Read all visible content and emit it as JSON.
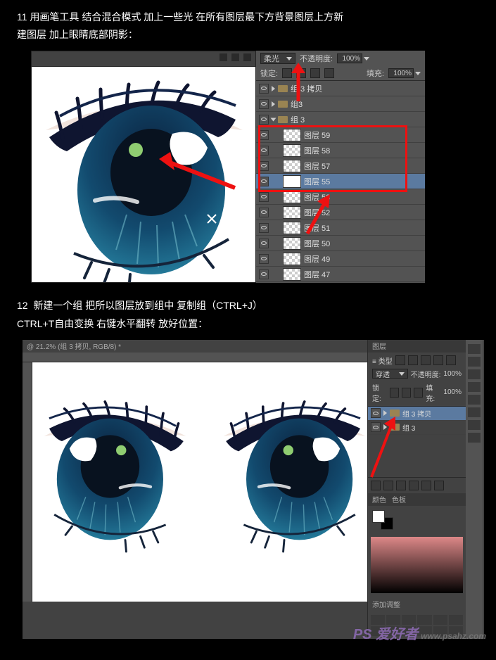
{
  "step11": {
    "num": "11",
    "text_line1": "用画笔工具  结合混合模式  加上一些光  在所有图层最下方背景图层上方新",
    "text_line2": "建图层  加上眼睛底部阴影："
  },
  "step12": {
    "num": "12",
    "text_line1": "新建一个组  把所以图层放到组中  复制组（CTRL+J）",
    "text_line2": "CTRL+T自由变换  右键水平翻转  放好位置："
  },
  "panel1": {
    "blend": "柔光",
    "opacity_label": "不透明度:",
    "opacity_val": "100%",
    "lock_label": "锁定:",
    "fill_label": "填充:",
    "fill_val": "100%",
    "groups": [
      {
        "name": "组 3 拷贝"
      },
      {
        "name": "组3"
      },
      {
        "name": "组 3"
      }
    ],
    "layers": [
      {
        "name": "图层 59"
      },
      {
        "name": "图层 58"
      },
      {
        "name": "图层 57"
      },
      {
        "name": "图层 55",
        "selected": true
      },
      {
        "name": "图层 53"
      },
      {
        "name": "图层 52"
      },
      {
        "name": "图层 51"
      },
      {
        "name": "图层 50"
      },
      {
        "name": "图层 49"
      },
      {
        "name": "图层 47"
      }
    ]
  },
  "panel2": {
    "doc_title": "@ 21.2% (组 3 拷贝, RGB/8) *",
    "tab_layer": "图层",
    "kind_label": "≡ 类型",
    "blend": "穿透",
    "opacity_label": "不透明度:",
    "opacity_val": "100%",
    "lock_label": "锁定:",
    "fill_label": "填充:",
    "fill_val": "100%",
    "groups": [
      {
        "name": "组 3 拷贝",
        "selected": true
      },
      {
        "name": "组 3"
      }
    ],
    "color_tab": "颜色",
    "swatch_tab": "色板",
    "adjust_label": "添加调整"
  },
  "watermark": {
    "main": "PS 爱好者",
    "sub": "www.psahz.com"
  }
}
